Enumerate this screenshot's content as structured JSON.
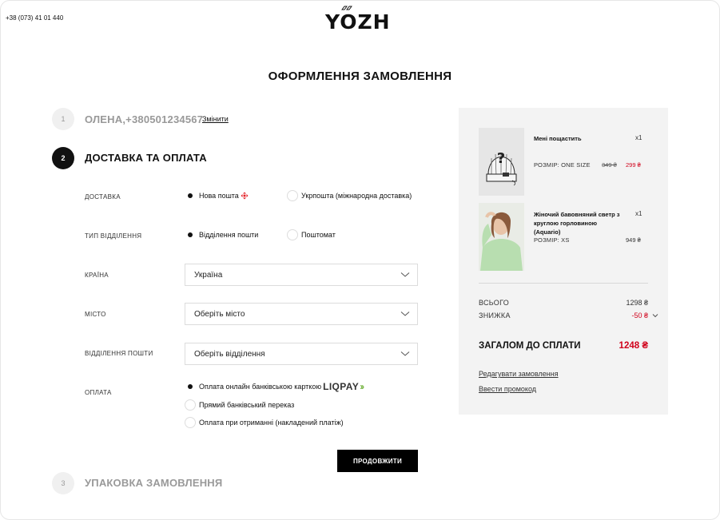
{
  "header": {
    "phone": "+38 (073) 41 01 440",
    "logo_text": "YOZH"
  },
  "page_title": "ОФОРМЛЕННЯ ЗАМОВЛЕННЯ",
  "steps": [
    {
      "number": "1",
      "title": "ОЛЕНА,+380501234567",
      "change_label": "Змінити"
    },
    {
      "number": "2",
      "title": "ДОСТАВКА ТА ОПЛАТА"
    },
    {
      "number": "3",
      "title": "УПАКОВКА ЗАМОВЛЕННЯ"
    }
  ],
  "form": {
    "delivery": {
      "label": "ДОСТАВКА",
      "options": [
        "Нова пошта",
        "Укрпошта (міжнародна доставка)"
      ],
      "selected": 0
    },
    "branch_type": {
      "label": "ТИП ВІДДІЛЕННЯ",
      "options": [
        "Відділення пошти",
        "Поштомат"
      ],
      "selected": 0
    },
    "country": {
      "label": "КРАЇНА",
      "value": "Україна"
    },
    "city": {
      "label": "МІСТО",
      "value": "Оберіть місто"
    },
    "post_office": {
      "label": "ВІДДІЛЕННЯ ПОШТИ",
      "value": "Оберіть відділення"
    },
    "payment": {
      "label": "ОПЛАТА",
      "options": [
        "Оплата онлайн банківською карткою",
        "Прямий банківський переказ",
        "Оплата при отриманні (накладений платіж)"
      ],
      "liqpay_text": "LIQPAY",
      "selected": 0
    },
    "continue_label": "ПРОДОВЖИТИ"
  },
  "summary": {
    "items": [
      {
        "name": "Мені пощастить",
        "qty": "x1",
        "size": "РОЗМІР: ONE SIZE",
        "old_price": "349 ₴",
        "price": "299 ₴"
      },
      {
        "name_lines": [
          "Жіночий бавовняний светр з",
          "круглою горловиною",
          "(Aquario)"
        ],
        "qty": "x1",
        "size": "РОЗМІР: XS",
        "price": "949 ₴"
      }
    ],
    "subtotal_label": "ВСЬОГО",
    "subtotal_value": "1298 ₴",
    "discount_label": "ЗНИЖКА",
    "discount_value": "-50 ₴",
    "total_label": "ЗАГАЛОМ ДО СПЛАТИ",
    "total_value": "1248 ₴",
    "edit_order_label": "Редагувати замовлення",
    "promo_label": "Ввести промокод"
  },
  "colors": {
    "accent_red": "#d0021b",
    "liqpay_green": "#7ab648",
    "nova_poshta_red": "#e31e24"
  }
}
